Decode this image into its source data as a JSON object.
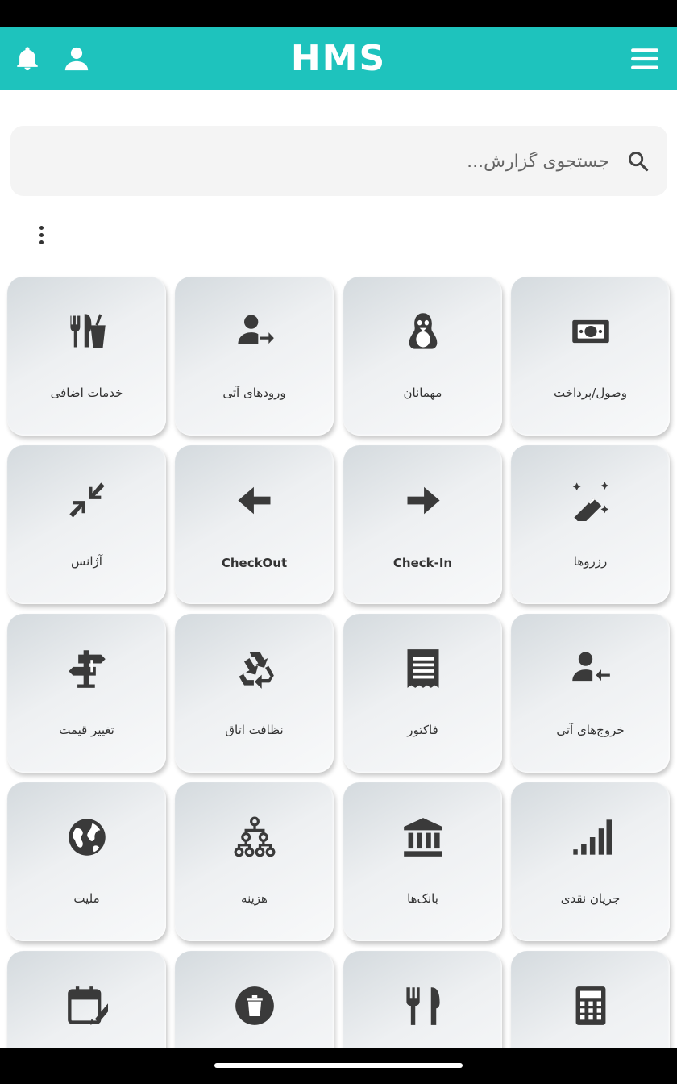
{
  "appbar": {
    "title": "HMS",
    "menu_icon": "hamburger-menu-icon",
    "notification_icon": "bell-icon",
    "profile_icon": "person-icon",
    "color": "#1ec3bd"
  },
  "search": {
    "placeholder": "جستجوی گزارش...",
    "value": "",
    "icon": "search-icon"
  },
  "more_icon": "vertical-dots-icon",
  "tiles": [
    {
      "label": "وصول/پرداخت",
      "icon": "money-bill-icon"
    },
    {
      "label": "مهمانان",
      "icon": "penguin-icon"
    },
    {
      "label": "ورودهای آتی",
      "icon": "user-arrow-right-icon"
    },
    {
      "label": "خدمات اضافی",
      "icon": "utensils-drink-icon"
    },
    {
      "label": "رزروها",
      "icon": "magic-wand-icon"
    },
    {
      "label": "Check-In",
      "icon": "arrow-right-icon"
    },
    {
      "label": "CheckOut",
      "icon": "arrow-left-icon"
    },
    {
      "label": "آژانس",
      "icon": "compress-icon"
    },
    {
      "label": "خروج‌های آتی",
      "icon": "user-arrow-left-icon"
    },
    {
      "label": "فاکتور",
      "icon": "receipt-icon"
    },
    {
      "label": "نظافت اتاق",
      "icon": "recycle-icon"
    },
    {
      "label": "تغییر قیمت",
      "icon": "signpost-icon"
    },
    {
      "label": "جریان نقدی",
      "icon": "signal-bars-icon"
    },
    {
      "label": "بانک‌ها",
      "icon": "bank-icon"
    },
    {
      "label": "هزینه",
      "icon": "hierarchy-icon"
    },
    {
      "label": "ملیت",
      "icon": "globe-icon"
    },
    {
      "label": "",
      "icon": "calculator-icon"
    },
    {
      "label": "",
      "icon": "fork-knife-icon"
    },
    {
      "label": "",
      "icon": "trash-icon"
    },
    {
      "label": "",
      "icon": "calendar-edit-icon"
    }
  ]
}
